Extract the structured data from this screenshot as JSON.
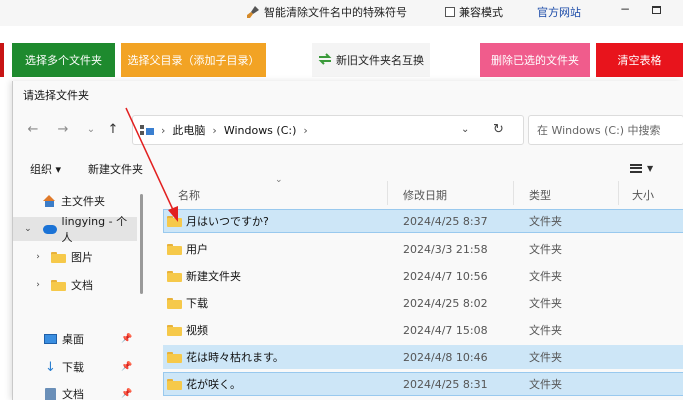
{
  "app": {
    "title": "智能清除文件名中的特殊符号",
    "compat_mode": "兼容模式",
    "official_site": "官方网站",
    "minimize": "−",
    "buttons": {
      "select_multi": "选择多个文件夹",
      "select_parent": "选择父目录（添加子目录）",
      "swap_names": "新旧文件夹名互换",
      "delete_selected": "删除已选的文件夹",
      "clear_table": "清空表格"
    },
    "colors": {
      "green": "#1e8a2e",
      "orange": "#f2a324",
      "pink": "#f05c8c",
      "red": "#e8141c"
    }
  },
  "dialog": {
    "title": "请选择文件夹",
    "nav": {
      "back": "←",
      "forward": "→",
      "recent": "⌄",
      "up": "↑"
    },
    "address": {
      "crumbs": [
        "此电脑",
        "Windows (C:)"
      ],
      "dropdown": "⌄",
      "refresh": "↻"
    },
    "search_placeholder": "在 Windows (C:) 中搜索",
    "commands": {
      "organize": "组织 ▾",
      "new_folder": "新建文件夹"
    },
    "sidebar": {
      "items": [
        {
          "label": "主文件夹",
          "icon": "home-icon"
        },
        {
          "label": "lingying - 个人",
          "icon": "cloud-icon"
        },
        {
          "label": "图片",
          "icon": "folder-icon"
        },
        {
          "label": "文档",
          "icon": "folder-icon"
        },
        {
          "label": "桌面",
          "icon": "desktop-icon"
        },
        {
          "label": "下载",
          "icon": "download-icon"
        },
        {
          "label": "文档",
          "icon": "document-icon"
        }
      ]
    },
    "columns": {
      "name": "名称",
      "modified": "修改日期",
      "type": "类型",
      "size": "大小"
    },
    "files": [
      {
        "name": "月はいつですか?",
        "modified": "2024/4/25 8:37",
        "type": "文件夹",
        "selected": true
      },
      {
        "name": "用户",
        "modified": "2024/3/3 21:58",
        "type": "文件夹",
        "selected": false
      },
      {
        "name": "新建文件夹",
        "modified": "2024/4/7 10:56",
        "type": "文件夹",
        "selected": false
      },
      {
        "name": "下载",
        "modified": "2024/4/25 8:02",
        "type": "文件夹",
        "selected": false
      },
      {
        "name": "视频",
        "modified": "2024/4/7 15:08",
        "type": "文件夹",
        "selected": false
      },
      {
        "name": "花は時々枯れます。",
        "modified": "2024/4/8 10:46",
        "type": "文件夹",
        "selected": true
      },
      {
        "name": "花が咲く。",
        "modified": "2024/4/25 8:31",
        "type": "文件夹",
        "selected": true
      }
    ]
  }
}
